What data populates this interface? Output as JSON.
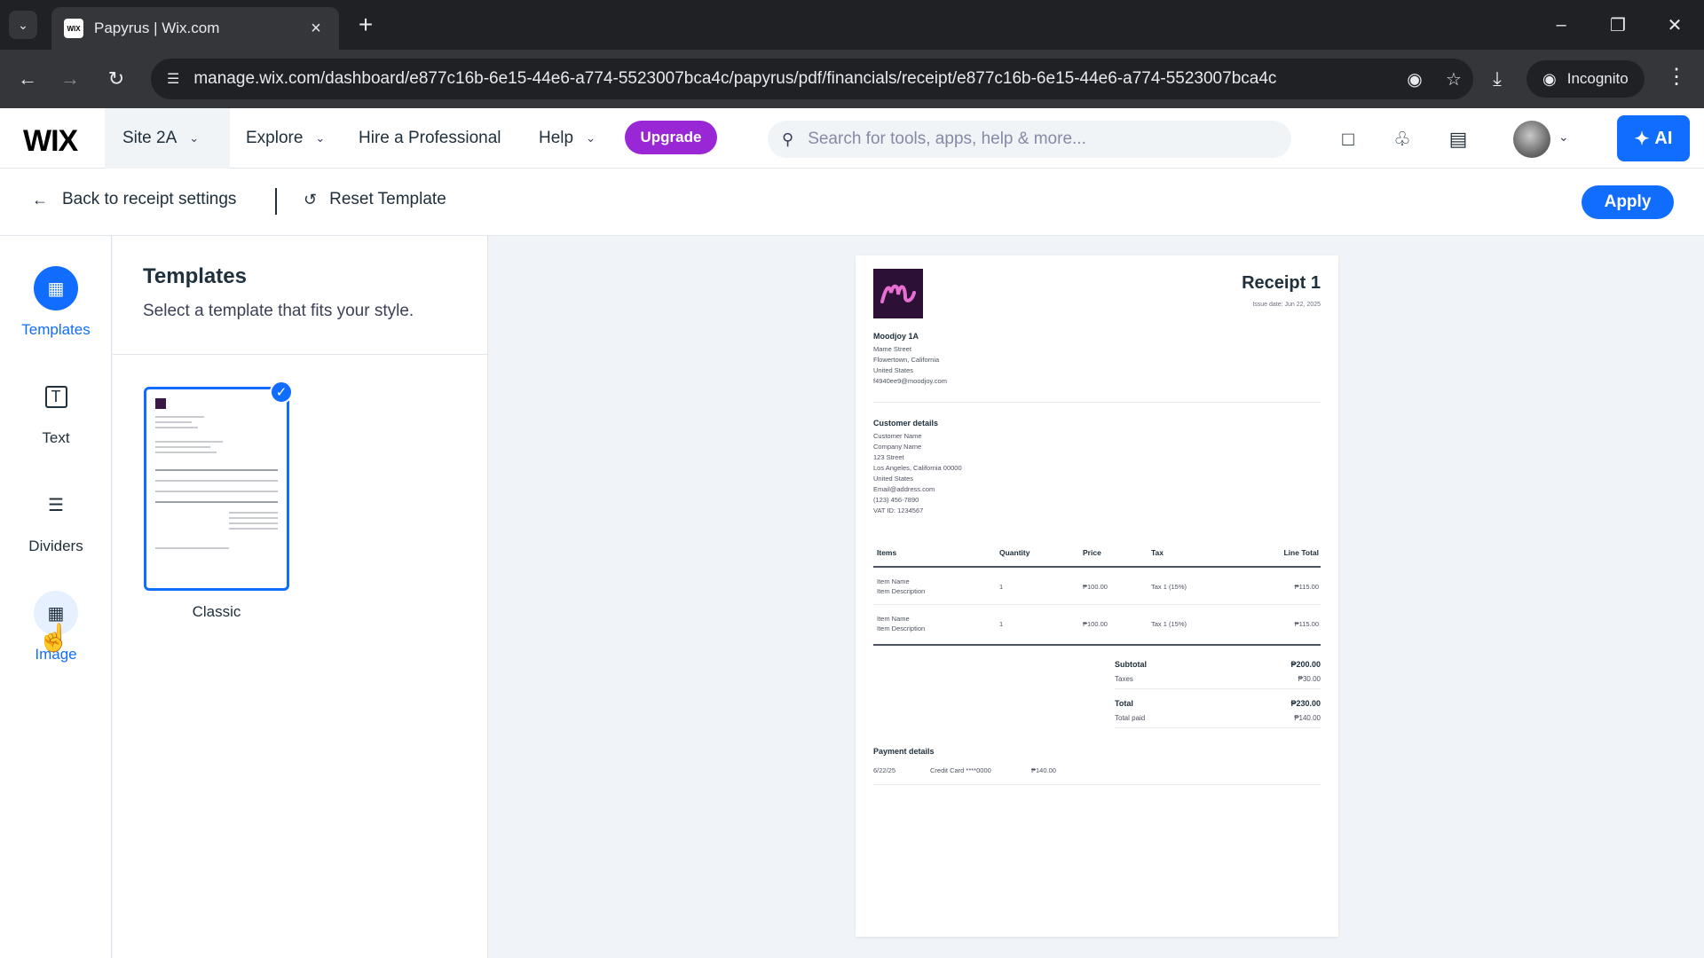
{
  "browser": {
    "tab_title": "Papyrus | Wix.com",
    "favicon_text": "WIX",
    "url": "manage.wix.com/dashboard/e877c16b-6e15-44e6-a774-5523007bca4c/papyrus/pdf/financials/receipt/e877c16b-6e15-44e6-a774-5523007bca4c",
    "incognito_label": "Incognito"
  },
  "wix": {
    "logo": "WIX",
    "site_name": "Site 2A",
    "nav": {
      "explore": "Explore",
      "hire": "Hire a Professional",
      "help": "Help"
    },
    "upgrade_label": "Upgrade",
    "search_placeholder": "Search for tools, apps, help & more...",
    "ai_label": "AI"
  },
  "editor": {
    "back_label": "Back to receipt settings",
    "reset_label": "Reset Template",
    "apply_label": "Apply"
  },
  "rail": [
    {
      "label": "Templates",
      "icon": "layout-icon",
      "state": "active"
    },
    {
      "label": "Text",
      "icon": "text-icon",
      "state": "normal"
    },
    {
      "label": "Dividers",
      "icon": "dividers-icon",
      "state": "normal"
    },
    {
      "label": "Image",
      "icon": "image-icon",
      "state": "hover"
    }
  ],
  "panel": {
    "title": "Templates",
    "subtitle": "Select a template that fits your style.",
    "templates": [
      {
        "name": "Classic",
        "selected": true
      }
    ]
  },
  "receipt": {
    "title": "Receipt 1",
    "issue_date": "Issue date: Jun 22, 2025",
    "company": {
      "name": "Moodjoy 1A",
      "lines": [
        "Mame Street",
        "Flowertown, California",
        "United States",
        "f4940ee9@moodjoy.com"
      ]
    },
    "customer": {
      "heading": "Customer details",
      "lines": [
        "Customer Name",
        "Company Name",
        "123 Street",
        "Los Angeles, California 00000",
        "United States",
        "Email@address.com",
        "(123) 456-7890",
        "VAT ID: 1234567"
      ]
    },
    "table": {
      "headers": [
        "Items",
        "Quantity",
        "Price",
        "Tax",
        "Line Total"
      ],
      "rows": [
        {
          "item": "Item Name",
          "desc": "Item Description",
          "qty": "1",
          "price": "₱100.00",
          "tax": "Tax 1 (15%)",
          "total": "₱115.00"
        },
        {
          "item": "Item Name",
          "desc": "Item Description",
          "qty": "1",
          "price": "₱100.00",
          "tax": "Tax 1 (15%)",
          "total": "₱115.00"
        }
      ]
    },
    "summary": {
      "subtotal_label": "Subtotal",
      "subtotal": "₱200.00",
      "taxes_label": "Taxes",
      "taxes": "₱30.00",
      "total_label": "Total",
      "total": "₱230.00",
      "paid_label": "Total paid",
      "paid": "₱140.00"
    },
    "payment": {
      "heading": "Payment details",
      "date": "6/22/25",
      "method": "Credit Card ****0000",
      "amount": "₱140.00"
    }
  },
  "colors": {
    "wix_blue": "#116dff",
    "upgrade_purple": "#9a27d5",
    "logo_bg": "#2d1035"
  }
}
